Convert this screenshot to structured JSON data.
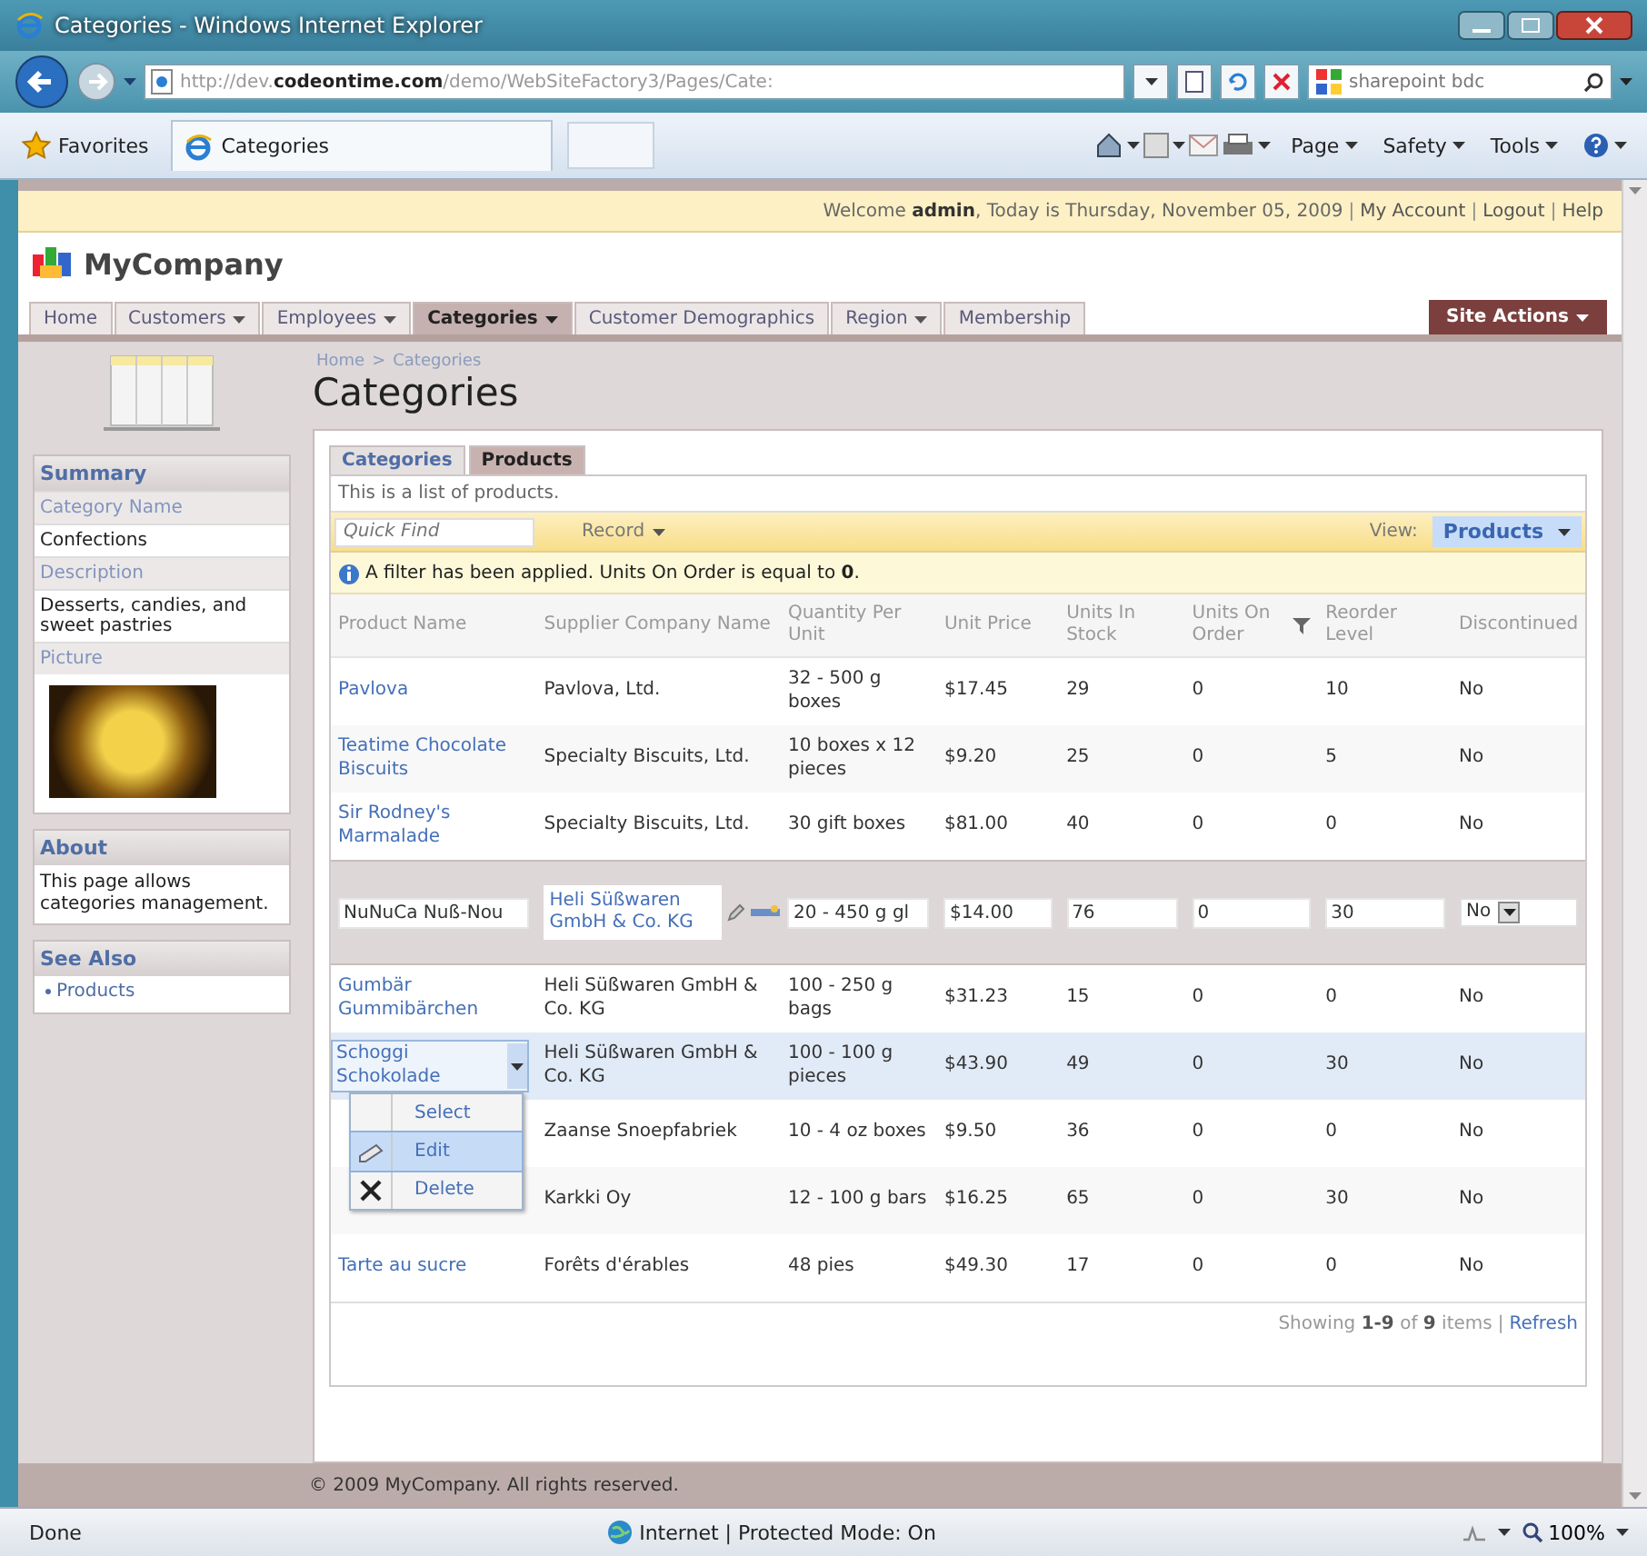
{
  "window": {
    "title": "Categories - Windows Internet Explorer"
  },
  "address_bar": {
    "url": "http://dev.**codeontime.com**/demo/WebSiteFactory3/Pages/Cate:",
    "search_value": "sharepoint bdc"
  },
  "favorites_bar": {
    "favorites": "Favorites",
    "tab": "Categories",
    "commands": [
      "Page",
      "Safety",
      "Tools"
    ]
  },
  "site_header": {
    "welcome": "Welcome **admin**, Today is Thursday, November 05, 2009",
    "links": [
      "My Account",
      "Logout",
      "Help"
    ],
    "separator": "|",
    "logo": "MyCompany",
    "menu": [
      {
        "label": "Home",
        "has_menu": false,
        "selected": false
      },
      {
        "label": "Customers",
        "has_menu": true,
        "selected": false
      },
      {
        "label": "Employees",
        "has_menu": true,
        "selected": false
      },
      {
        "label": "Categories",
        "has_menu": true,
        "selected": true
      },
      {
        "label": "Customer Demographics",
        "has_menu": false,
        "selected": false
      },
      {
        "label": "Region",
        "has_menu": true,
        "selected": false
      },
      {
        "label": "Membership",
        "has_menu": false,
        "selected": false
      }
    ],
    "site_actions": "Site Actions"
  },
  "sidebar": {
    "summary": {
      "title": "Summary",
      "fields": [
        {
          "kind": "text",
          "label": "Category Name",
          "value": "Confections"
        },
        {
          "kind": "text",
          "label": "Description",
          "value": "Desserts, candies, and sweet pastries"
        },
        {
          "kind": "image",
          "label": "Picture"
        }
      ]
    },
    "about": {
      "title": "About",
      "text": "This page allows categories management."
    },
    "see_also": {
      "title": "See Also",
      "links": [
        "Products"
      ]
    }
  },
  "breadcrumb": {
    "items": [
      "Home",
      "Categories"
    ],
    "separator": ">"
  },
  "title": "Categories",
  "tabs": [
    {
      "label": "Categories",
      "selected": false
    },
    {
      "label": "Products",
      "selected": true
    }
  ],
  "description": "This is a list of products.",
  "toolbar": {
    "quick_find_placeholder": "Quick Find",
    "actions": [
      "Record"
    ],
    "view_label": "View:",
    "view_value": "Products"
  },
  "filter_notice": "A filter has been applied. Units On Order is equal to **0**.",
  "grid": {
    "columns": [
      {
        "label": "Product Name",
        "filtered": false
      },
      {
        "label": "Supplier Company Name",
        "filtered": false
      },
      {
        "label": "Quantity Per Unit",
        "filtered": false
      },
      {
        "label": "Unit Price",
        "filtered": false
      },
      {
        "label": "Units In Stock",
        "filtered": false
      },
      {
        "label": "Units On Order",
        "filtered": true
      },
      {
        "label": "Reorder Level",
        "filtered": false
      },
      {
        "label": "Discontinued",
        "filtered": false
      }
    ],
    "rows": [
      {
        "kind": "view",
        "selected": false,
        "product_name": "Pavlova",
        "values": [
          "Pavlova, Ltd.",
          "32 - 500 g boxes",
          "$17.45",
          "29",
          "0",
          "10",
          "No"
        ]
      },
      {
        "kind": "view",
        "selected": false,
        "product_name": "Teatime Chocolate Biscuits",
        "values": [
          "Specialty Biscuits, Ltd.",
          "10 boxes x 12 pieces",
          "$9.20",
          "25",
          "0",
          "5",
          "No"
        ]
      },
      {
        "kind": "view",
        "selected": false,
        "product_name": "Sir Rodney's Marmalade",
        "values": [
          "Specialty Biscuits, Ltd.",
          "30 gift boxes",
          "$81.00",
          "40",
          "0",
          "0",
          "No"
        ]
      },
      {
        "kind": "edit",
        "selected": false,
        "product_name": "NuNuCa Nuß-Nou",
        "values": [
          "Heli Süßwaren GmbH & Co. KG",
          "20 - 450 g gl",
          "$14.00",
          "76",
          "0",
          "30",
          "No"
        ]
      },
      {
        "kind": "view",
        "selected": false,
        "product_name": "Gumbär Gummibärchen",
        "values": [
          "Heli Süßwaren GmbH & Co. KG",
          "100 - 250 g bags",
          "$31.23",
          "15",
          "0",
          "0",
          "No"
        ]
      },
      {
        "kind": "view",
        "selected": true,
        "product_name": "Schoggi Schokolade",
        "values": [
          "Heli Süßwaren GmbH & Co. KG",
          "100 - 100 g pieces",
          "$43.90",
          "49",
          "0",
          "30",
          "No"
        ]
      },
      {
        "kind": "view",
        "selected": false,
        "values": [
          "Zaanse Snoepfabriek",
          "10 - 4 oz boxes",
          "$9.50",
          "36",
          "0",
          "0",
          "No"
        ]
      },
      {
        "kind": "view",
        "selected": false,
        "values": [
          "Karkki Oy",
          "12 - 100 g bars",
          "$16.25",
          "65",
          "0",
          "30",
          "No"
        ]
      },
      {
        "kind": "view",
        "selected": false,
        "product_name": "Tarte au sucre",
        "values": [
          "Forêts d'érables",
          "48 pies",
          "$49.30",
          "17",
          "0",
          "0",
          "No"
        ]
      }
    ],
    "context_menu": [
      {
        "kind": "plain",
        "label": "Select",
        "selected": false
      },
      {
        "kind": "edit",
        "label": "Edit",
        "selected": true
      },
      {
        "kind": "delete",
        "label": "Delete",
        "selected": false
      }
    ],
    "pager": {
      "text": "Showing **1-9** of **9** items",
      "separator": "|",
      "link": "Refresh"
    }
  },
  "footer": "© 2009 MyCompany. All rights reserved.",
  "status_bar": {
    "status": "Done",
    "zone": "Internet | Protected Mode: On",
    "zoom": "100%"
  }
}
